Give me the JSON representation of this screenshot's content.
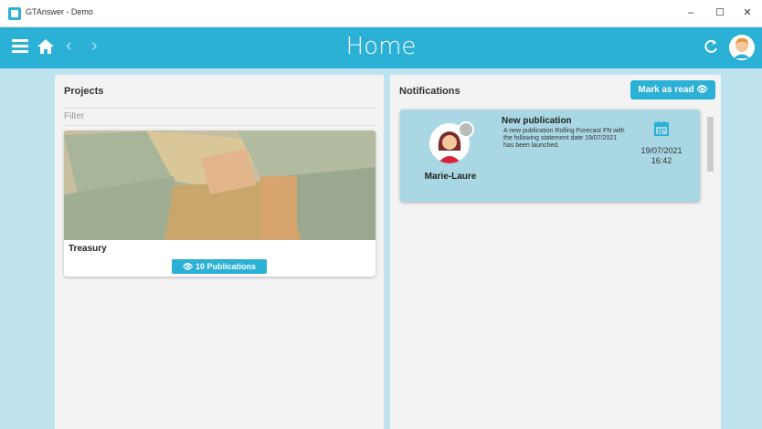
{
  "window": {
    "title": "GTAnswer - Demo",
    "minimize": "–",
    "maximize": "☐",
    "close": "✕"
  },
  "topbar": {
    "title": "Home",
    "back": "‹",
    "forward": "›"
  },
  "projects": {
    "title": "Projects",
    "filter_placeholder": "Filter",
    "card": {
      "label": "Treasury",
      "publications": "👁 10 Publications"
    }
  },
  "notifications": {
    "title": "Notifications",
    "mark_read": "Mark as read 👁",
    "items": [
      {
        "author": "Marie-Laure",
        "title": "New publication",
        "body": "A new publication Rolling Forecast FN with the following statement date 19/07/2021 has been launched.",
        "date": "19/07/2021",
        "time": "16:42"
      }
    ]
  },
  "colors": {
    "accent": "#2bb0d6",
    "notification_bg": "#a9d8e4",
    "page_bg": "#bfe3ee"
  }
}
